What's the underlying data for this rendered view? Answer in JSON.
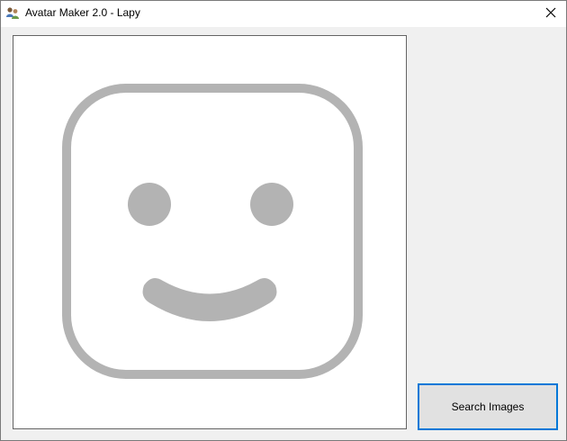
{
  "window": {
    "title": "Avatar Maker 2.0 - Lapy",
    "app_icon": "users-icon",
    "close_icon": "close-icon"
  },
  "preview": {
    "placeholder_icon": "smiley-face-icon",
    "icon_color": "#b3b3b3"
  },
  "actions": {
    "search_images_label": "Search Images",
    "focus_color": "#0078d7"
  }
}
